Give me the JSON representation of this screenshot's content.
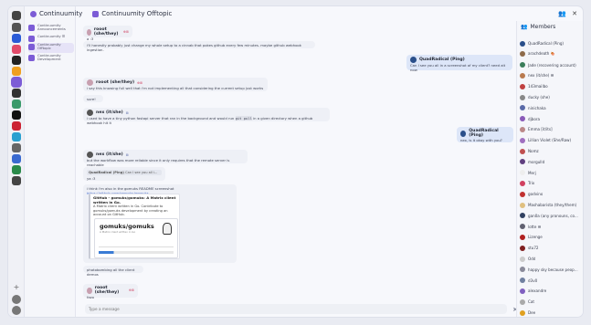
{
  "header": {
    "space_title": "Continuumity",
    "room_title": "Continuumity Offtopic"
  },
  "rooms": [
    {
      "name": "Continuumity Announcements",
      "color": "#7c5cd6"
    },
    {
      "name": "Continuumity ☰",
      "color": "#7c5cd6"
    },
    {
      "name": "Continuumity Offtopic",
      "color": "#7c5cd6",
      "active": true
    },
    {
      "name": "Continuumity Development",
      "color": "#7c5cd6"
    }
  ],
  "timeline": {
    "m1": {
      "text": "a :3"
    },
    "m2": {
      "text": "i'll honestly probably just change my whole setup to a cinnab that pokes github every few minutes. maybe github webhook ingestion."
    },
    "m3": {
      "user": "QuadRadical (Ping)",
      "text": "Can I see you all in a screenshot of my client? need alt now"
    },
    "m4": {
      "user": "rooot (she/they)",
      "badge": "⊕⊞",
      "text": "i say this knowing full well that i'm not implementing all that considering the current setup just works"
    },
    "m5": {
      "text": "sure!"
    },
    "m6": {
      "user": "nex (it/she)",
      "badge": "⊞",
      "text_a": "i used to have a tiny python fastapi server that ran in the background and would run ",
      "code": "git pull",
      "text_b": " in a given directory when a github webhook hit it"
    },
    "m7": {
      "user": "QuadRadical (Ping)",
      "text": "nex, is it okay with you?"
    },
    "m8": {
      "user": "nex (it/she)",
      "badge": "⊞",
      "text": "but the workflow was more reliable since it only requires that the remote server is reachable"
    },
    "m9": {
      "reply_user": "QuadRadical (Ping)",
      "reply_text": "Can I see you all i...",
      "text": "ya :3"
    },
    "m10": {
      "text_a": "i think i'm also in the gomuks README screenshot ",
      "link": "https://github.com/gomuks/gomuks",
      "embed_title": "GitHub - gomuks/gomuks: A Matrix client written in Go.",
      "embed_desc": "A Matrix client written in Go. Contribute to gomuks/gomuks development by creating an account on GitHub.",
      "shot_title": "gomuks/gomuks",
      "shot_sub": "A Matrix client written in Go"
    },
    "m11": {
      "text": "photobombing all the client demos"
    },
    "m12": {
      "user": "rooot (she/they)",
      "badge": "⊕⊞",
      "text": "fazo"
    }
  },
  "composer": {
    "placeholder": "Type a message"
  },
  "members": {
    "title": "Members",
    "list": [
      {
        "name": "QuadRadical (Ping)",
        "color": "#2a4f8a"
      },
      {
        "name": "arachdeath 🍖",
        "color": "#8e6b4a"
      },
      {
        "name": "Jade (recovering account)",
        "color": "#3b7d5a"
      },
      {
        "name": "nex (it/she) ☰",
        "color": "#b97a4e"
      },
      {
        "name": "143mailbo",
        "color": "#c04040"
      },
      {
        "name": "ducky (she)",
        "color": "#888"
      },
      {
        "name": "ninichaka",
        "color": "#5a6aa8"
      },
      {
        "name": "djbora",
        "color": "#8a5ab8"
      },
      {
        "name": "Emma [it/its]",
        "color": "#b88"
      },
      {
        "name": "Lillian Violet (She/Raw)",
        "color": "#a070c0"
      },
      {
        "name": "Nomz",
        "color": "#c05050"
      },
      {
        "name": "morgulld",
        "color": "#604080"
      },
      {
        "name": "Merj",
        "color": "#eee"
      },
      {
        "name": "Trix",
        "color": "#d04060"
      },
      {
        "name": "godvino",
        "color": "#c03030"
      },
      {
        "name": "Mashabarista (they/them)",
        "color": "#e0c080"
      },
      {
        "name": "gan0a (any pronouns, co...",
        "color": "#304060"
      },
      {
        "name": "lotte ☰",
        "color": "#606070"
      },
      {
        "name": "Lizenge",
        "color": "#b02020"
      },
      {
        "name": "stu72",
        "color": "#802020"
      },
      {
        "name": "Odd",
        "color": "#ccc"
      },
      {
        "name": "happy sky because peop...",
        "color": "#8a8a9a"
      },
      {
        "name": "d3v0",
        "color": "#7080a0"
      },
      {
        "name": "alexandre",
        "color": "#8060c0"
      },
      {
        "name": "Cat",
        "color": "#aaa"
      },
      {
        "name": "Dee",
        "color": "#e0a020"
      }
    ]
  }
}
